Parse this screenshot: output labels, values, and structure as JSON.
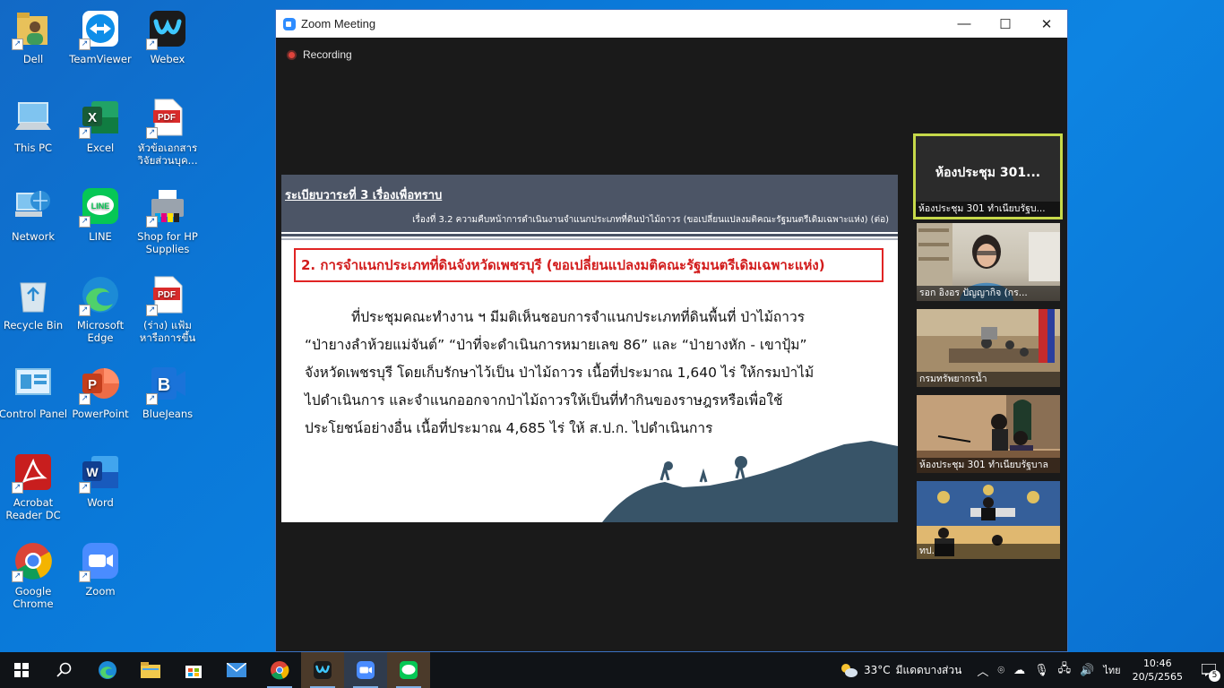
{
  "desktop": {
    "icons": [
      {
        "label": "Dell"
      },
      {
        "label": "TeamViewer"
      },
      {
        "label": "Webex"
      },
      {
        "label": "This PC"
      },
      {
        "label": "Excel"
      },
      {
        "label": "หัวข้อเอกสาร วิจัยส่วนบุค..."
      },
      {
        "label": "Network"
      },
      {
        "label": "LINE"
      },
      {
        "label": "Shop for HP Supplies"
      },
      {
        "label": "Recycle Bin"
      },
      {
        "label": "Microsoft Edge"
      },
      {
        "label": "(ร่าง) แฟ้ม หารือการขึ้นท..."
      },
      {
        "label": "Control Panel"
      },
      {
        "label": "PowerPoint"
      },
      {
        "label": "BlueJeans"
      },
      {
        "label": "Acrobat Reader DC"
      },
      {
        "label": "Word"
      },
      {
        "label": "Google Chrome"
      },
      {
        "label": "Zoom"
      }
    ]
  },
  "zoom": {
    "title": "Zoom Meeting",
    "recording_label": "Recording",
    "slide": {
      "agenda": "ระเบียบวาระที่ 3  เรื่องเพื่อทราบ",
      "subtitle": "เรื่องที่ 3.2  ความคืบหน้าการดำเนินงานจำแนกประเภทที่ดินป่าไม้ถาวร (ขอเปลี่ยนแปลงมติคณะรัฐมนตรีเดิมเฉพาะแห่ง) (ต่อ)",
      "box_title": "2. การจำแนกประเภทที่ดินจังหวัดเพชรบุรี (ขอเปลี่ยนแปลงมติคณะรัฐมนตรีเดิมเฉพาะแห่ง)",
      "body_lines": [
        "ที่ประชุมคณะทำงาน ฯ มีมติเห็นชอบการจำแนกประเภทที่ดินพื้นที่ ป่าไม้ถาวร",
        "“ป่ายางลำห้วยแม่จันต์” “ป่าที่จะดำเนินการหมายเลข 86” และ “ป่ายางหัก - เขาปุ้ม”",
        "จังหวัดเพชรบุรี โดยเก็บรักษาไว้เป็น ป่าไม้ถาวร เนื้อที่ประมาณ 1,640 ไร่ ให้กรมป่าไม้",
        "ไปดำเนินการ และจำแนกออกจากป่าไม้ถาวรให้เป็นที่ทำกินของราษฎรหรือเพื่อใช้",
        "ประโยชน์อย่างอื่น เนื้อที่ประมาณ 4,685 ไร่ ให้ ส.ป.ก. ไปดำเนินการ"
      ]
    },
    "participants": {
      "active": {
        "big_name": "ห้องประชุม 301...",
        "name": "ห้องประชุม 301 ทำเนียบรัฐบ..."
      },
      "tiles": [
        {
          "name": "รอก อิงอร ปัญญากิจ (กร..."
        },
        {
          "name": "กรมทรัพยากรน้ำ"
        },
        {
          "name": "ห้องประชุม 301 ทำเนียบรัฐบาล"
        },
        {
          "name": "ทป."
        }
      ]
    }
  },
  "taskbar": {
    "temperature": "33°C",
    "weather_text": "มีแดดบางส่วน",
    "language": "ไทย",
    "time": "10:46",
    "date": "20/5/2565",
    "notification_count": "5"
  }
}
